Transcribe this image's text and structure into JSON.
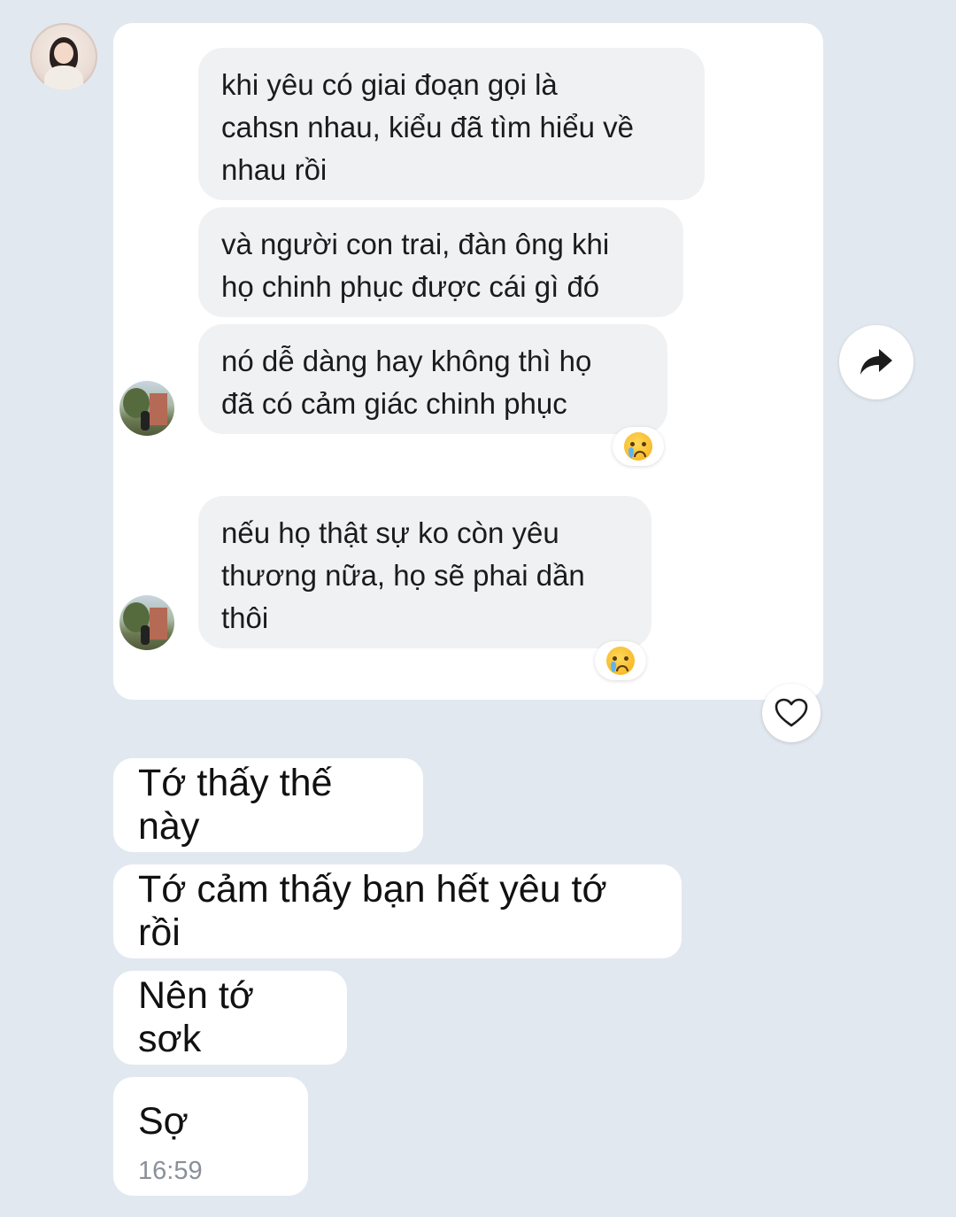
{
  "quoted": {
    "messages": [
      {
        "text": "khi yêu có giai đoạn gọi là\ncahsn nhau, kiểu đã tìm hiểu về\nnhau rồi"
      },
      {
        "text": "và người con trai, đàn ông khi\nhọ chinh phục được cái gì đó"
      },
      {
        "text": "nó dễ dàng hay không thì họ\nđã có cảm giác chinh phục",
        "reaction": "crying-face"
      },
      {
        "text": "nếu họ thật sự ko còn yêu\nthương nữa, họ sẽ phai dần\nthôi",
        "reaction": "crying-face"
      }
    ]
  },
  "messages": [
    {
      "text": "Tớ thấy thế này"
    },
    {
      "text": "Tớ cảm thấy bạn hết yêu tớ rồi"
    },
    {
      "text": "Nên tớ sơk"
    },
    {
      "text": "Sợ",
      "time": "16:59"
    }
  ],
  "icons": {
    "share": "share-arrow-icon",
    "like": "heart-icon",
    "reaction": "crying-face-emoji"
  },
  "colors": {
    "background": "#e2e8f0",
    "bubble": "#ffffff",
    "quoted_bubble": "#f0f1f2",
    "timestamp": "#8a9099"
  }
}
